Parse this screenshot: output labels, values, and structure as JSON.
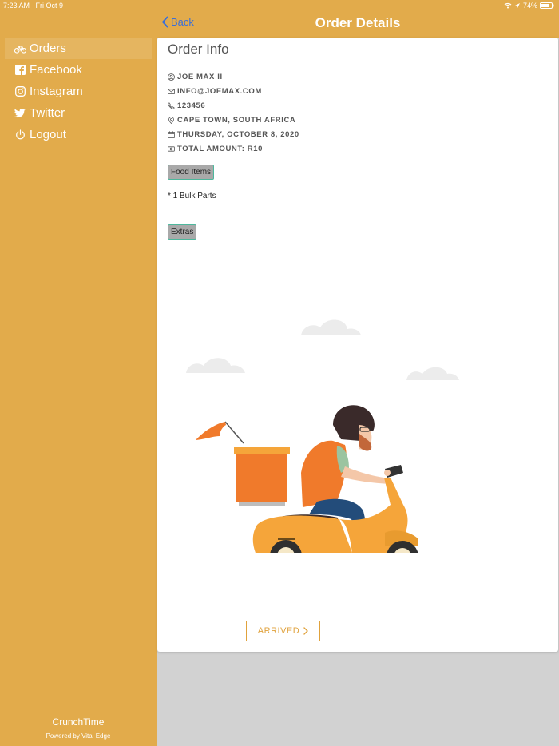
{
  "status_bar": {
    "time": "7:23 AM",
    "date": "Fri Oct 9",
    "battery": "74%"
  },
  "sidebar": {
    "items": [
      {
        "label": "Orders",
        "icon": "bicycle-icon",
        "active": true
      },
      {
        "label": "Facebook",
        "icon": "facebook-icon"
      },
      {
        "label": "Instagram",
        "icon": "instagram-icon"
      },
      {
        "label": "Twitter",
        "icon": "twitter-icon"
      },
      {
        "label": "Logout",
        "icon": "power-icon"
      }
    ],
    "brand_name": "CrunchTime",
    "brand_sub": "Powered by Vital Edge"
  },
  "header": {
    "back_label": "Back",
    "title": "Order Details"
  },
  "card": {
    "title": "Order Info",
    "info": {
      "name": "JOE MAX II",
      "email": "INFO@JOEMAX.COM",
      "phone": "123456",
      "location": "CAPE TOWN, SOUTH AFRICA",
      "date": "THURSDAY, OCTOBER 8, 2020",
      "total": "TOTAL AMOUNT: R10"
    },
    "food_items_label": "Food Items",
    "food_items": [
      "* 1 Bulk Parts"
    ],
    "extras_label": "Extras",
    "arrived_label": "ARRIVED"
  },
  "colors": {
    "brand": "#e2ab4b",
    "back_link": "#3a6fd8",
    "pill_bg": "#a9a9a9",
    "pill_border": "#4db89d"
  }
}
